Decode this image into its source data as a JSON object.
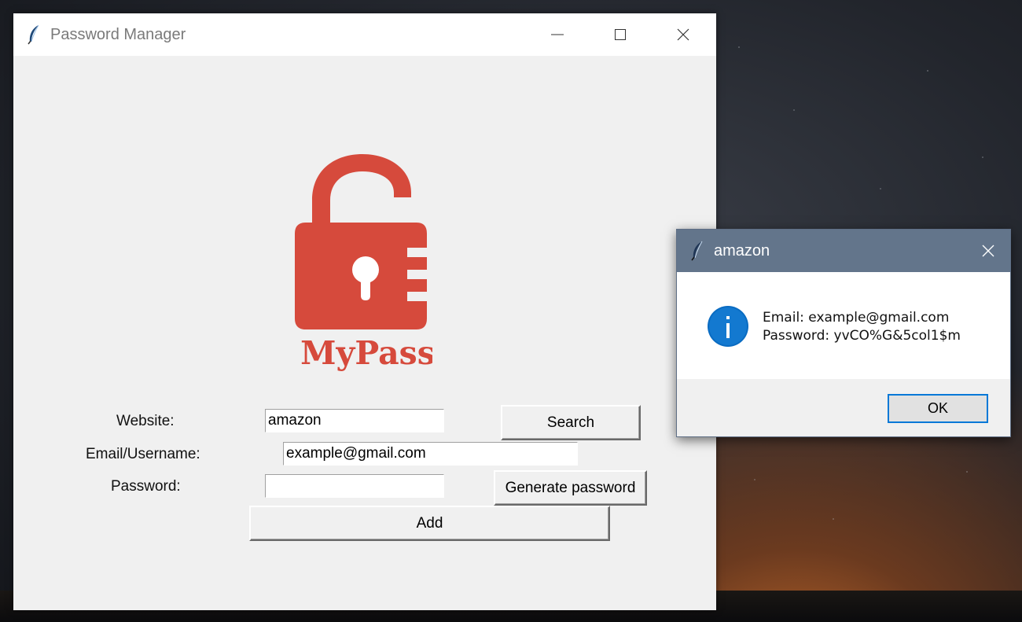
{
  "main_window": {
    "title": "Password Manager",
    "logo_text": "MyPass",
    "logo_color": "#d64a3c",
    "form": {
      "website_label": "Website:",
      "website_value": "amazon",
      "email_label": "Email/Username:",
      "email_value": "example@gmail.com",
      "password_label": "Password:",
      "password_value": "",
      "search_button": "Search",
      "generate_button": "Generate password",
      "add_button": "Add"
    }
  },
  "dialog": {
    "title": "amazon",
    "icon": "info-icon",
    "message_email": "Email: example@gmail.com",
    "message_password": "Password: yvCO%G&5col1$m",
    "ok_button": "OK",
    "titlebar_color": "#63758b"
  }
}
